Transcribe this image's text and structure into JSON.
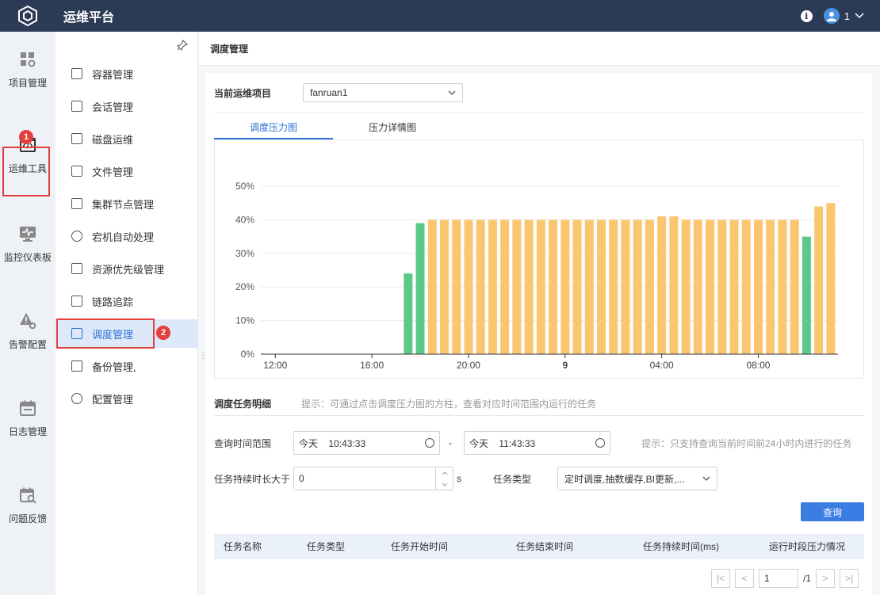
{
  "app": {
    "title": "运维平台"
  },
  "topbar": {
    "user_name": "1"
  },
  "leftnav": {
    "items": [
      {
        "label": "项目管理",
        "icon": "grid-settings-icon"
      },
      {
        "label": "运维工具",
        "icon": "code-window-icon"
      },
      {
        "label": "监控仪表板",
        "icon": "monitor-pulse-icon"
      },
      {
        "label": "告警配置",
        "icon": "warning-gear-icon"
      },
      {
        "label": "日志管理",
        "icon": "calendar-icon"
      },
      {
        "label": "问题反馈",
        "icon": "calendar-search-icon"
      }
    ]
  },
  "submenu": {
    "items": [
      {
        "label": "容器管理"
      },
      {
        "label": "会话管理"
      },
      {
        "label": "磁盘运维"
      },
      {
        "label": "文件管理"
      },
      {
        "label": "集群节点管理"
      },
      {
        "label": "宕机自动处理"
      },
      {
        "label": "资源优先级管理"
      },
      {
        "label": "链路追踪"
      },
      {
        "label": "调度管理"
      },
      {
        "label": "备份管理,"
      },
      {
        "label": "配置管理"
      }
    ]
  },
  "annotations": {
    "badge1": "1",
    "badge2": "2"
  },
  "page": {
    "title": "调度管理"
  },
  "project": {
    "label": "当前运维项目",
    "value": "fanruan1"
  },
  "tabs": [
    {
      "label": "调度压力图"
    },
    {
      "label": "压力详情图"
    }
  ],
  "colors": {
    "green": "#5cc987",
    "orange": "#fbc66f",
    "accent": "#2c6fd6"
  },
  "chart_data": {
    "type": "bar",
    "y_ticks": [
      "50%",
      "40%",
      "30%",
      "20%",
      "10%",
      "0%"
    ],
    "ylim": [
      0,
      50
    ],
    "x_ticks": [
      {
        "label": "12:00",
        "pos": 0.0,
        "bold": false
      },
      {
        "label": "16:00",
        "pos": 4.0,
        "bold": false
      },
      {
        "label": "20:00",
        "pos": 8.0,
        "bold": false
      },
      {
        "label": "9",
        "pos": 12.0,
        "bold": true
      },
      {
        "label": "04:00",
        "pos": 16.0,
        "bold": false
      },
      {
        "label": "08:00",
        "pos": 20.0,
        "bold": false
      }
    ],
    "x_start": -0.6,
    "x_end": 23.3,
    "bar_step": 0.5,
    "first_bar": 5.5,
    "values": [
      24,
      39,
      40,
      40,
      40,
      40,
      40,
      40,
      40,
      40,
      40,
      40,
      40,
      40,
      40,
      40,
      40,
      40,
      40,
      40,
      40,
      41,
      41,
      40,
      40,
      40,
      40,
      40,
      40,
      40,
      40,
      40,
      40,
      35,
      44,
      45
    ],
    "series_color_index": [
      0,
      0,
      1,
      1,
      1,
      1,
      1,
      1,
      1,
      1,
      1,
      1,
      1,
      1,
      1,
      1,
      1,
      1,
      1,
      1,
      1,
      1,
      1,
      1,
      1,
      1,
      1,
      1,
      1,
      1,
      1,
      1,
      1,
      0,
      1,
      1
    ]
  },
  "detail": {
    "title": "调度任务明细",
    "hint": "提示：可通过点击调度压力图的方柱，查看对应时间范围内运行的任务",
    "range_label": "查询时间范围",
    "start_day": "今天",
    "start_time": "10:43:33",
    "sep": "-",
    "end_day": "今天",
    "end_time": "11:43:33",
    "range_hint": "提示：只支持查询当前时间前24小时内进行的任务",
    "duration_label": "任务持续时长大于",
    "duration_value": "0",
    "duration_unit": "s",
    "type_label": "任务类型",
    "type_value": "定时调度,抽数缓存,BI更新,...",
    "query_button": "查询"
  },
  "table": {
    "columns": [
      "任务名称",
      "任务类型",
      "任务开始时间",
      "任务结束时间",
      "任务持续时间(ms)",
      "运行时段压力情况"
    ]
  },
  "pager": {
    "page": "1",
    "total": "/1"
  }
}
